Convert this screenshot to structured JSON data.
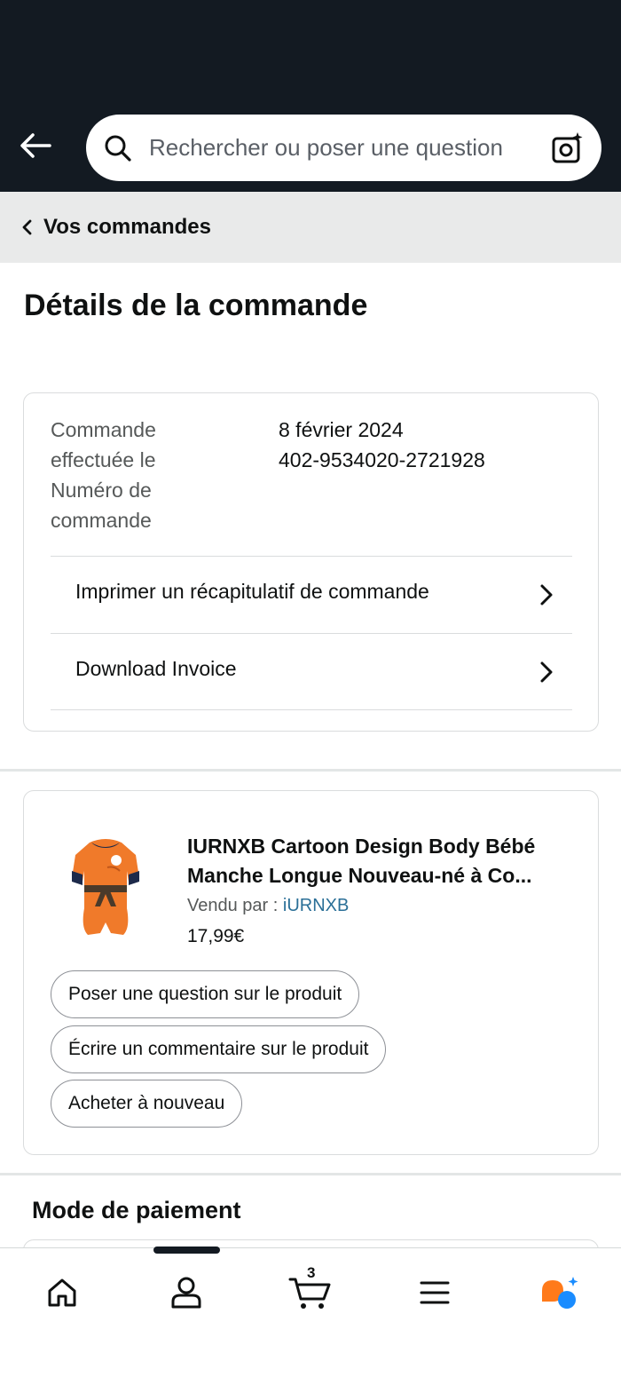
{
  "header": {
    "search_placeholder": "Rechercher ou poser une question"
  },
  "breadcrumb": {
    "label": "Vos commandes"
  },
  "page": {
    "title": "Détails de la commande"
  },
  "order": {
    "labels": "Commande effectuée le Numéro de commande",
    "date": "8 février 2024",
    "number": "402-9534020-2721928",
    "links": [
      {
        "label": "Imprimer un récapitulatif de commande"
      },
      {
        "label": "Download Invoice"
      }
    ]
  },
  "product": {
    "title": "IURNXB Cartoon Design Body Bébé Manche Longue Nouveau-né à Co...",
    "vendor_prefix": "Vendu par  :",
    "vendor_name": "iURNXB",
    "price": "17,99€",
    "actions": [
      {
        "label": "Poser une question sur le produit"
      },
      {
        "label": "Écrire un commentaire sur le produit"
      },
      {
        "label": "Acheter à nouveau"
      }
    ]
  },
  "payment": {
    "title": "Mode de paiement"
  },
  "bottom_nav": {
    "items": [
      {
        "icon": "home-icon"
      },
      {
        "icon": "account-icon",
        "active": true
      },
      {
        "icon": "cart-icon",
        "count": "3"
      },
      {
        "icon": "menu-icon"
      },
      {
        "icon": "rufus-assistant-icon"
      }
    ]
  },
  "colors": {
    "header_bg": "#131a22",
    "crumb_bg": "#e9eaea",
    "link": "#2a6f97",
    "assistant_orange": "#ff7a1a",
    "assistant_blue": "#1a8cff"
  }
}
